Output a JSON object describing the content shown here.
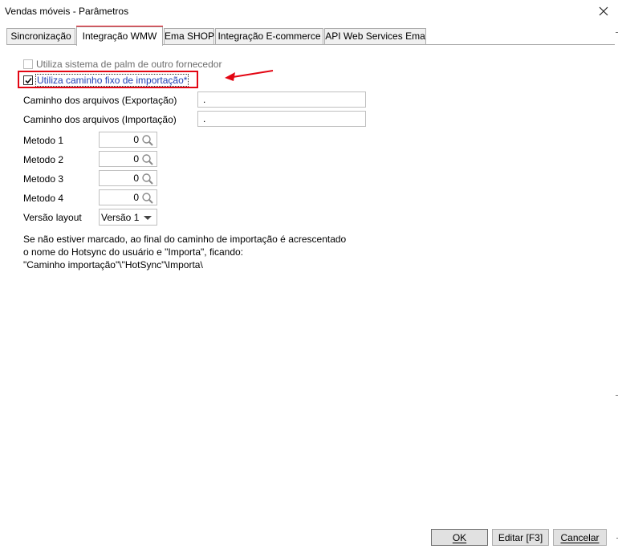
{
  "window": {
    "title": "Vendas móveis - Parâmetros",
    "close_glyph": "✕"
  },
  "tabs": [
    {
      "label": "Sincronização"
    },
    {
      "label": "Integração WMW",
      "active": true
    },
    {
      "label": "Ema SHOP"
    },
    {
      "label": "Integração E-commerce"
    },
    {
      "label": "API Web Services Ema"
    }
  ],
  "form": {
    "palm_checkbox": {
      "label": "Utiliza sistema de palm de outro fornecedor",
      "checked": false,
      "enabled": false
    },
    "fixed_path_checkbox": {
      "label": "Utiliza caminho fixo de importação*",
      "checked": true
    },
    "export_path": {
      "label": "Caminho dos arquivos (Exportação)",
      "value": "."
    },
    "import_path": {
      "label": "Caminho dos arquivos (Importação)",
      "value": "."
    },
    "metodos": [
      {
        "label": "Metodo 1",
        "value": "0"
      },
      {
        "label": "Metodo 2",
        "value": "0"
      },
      {
        "label": "Metodo 3",
        "value": "0"
      },
      {
        "label": "Metodo 4",
        "value": "0"
      }
    ],
    "layout_version": {
      "label": "Versão layout",
      "value": "Versão 1"
    }
  },
  "info_text": "Se não estiver marcado, ao final do caminho de importação é acrescentado\no nome do Hotsync do usuário e \"Importa\", ficando:\n\"Caminho importação\"\\\"HotSync\"\\Importa\\",
  "buttons": {
    "ok": "OK",
    "edit": "Editar [F3]",
    "cancel": "Cancelar"
  },
  "colors": {
    "highlight": "#e30613",
    "focus_text": "#1f3fb4"
  }
}
